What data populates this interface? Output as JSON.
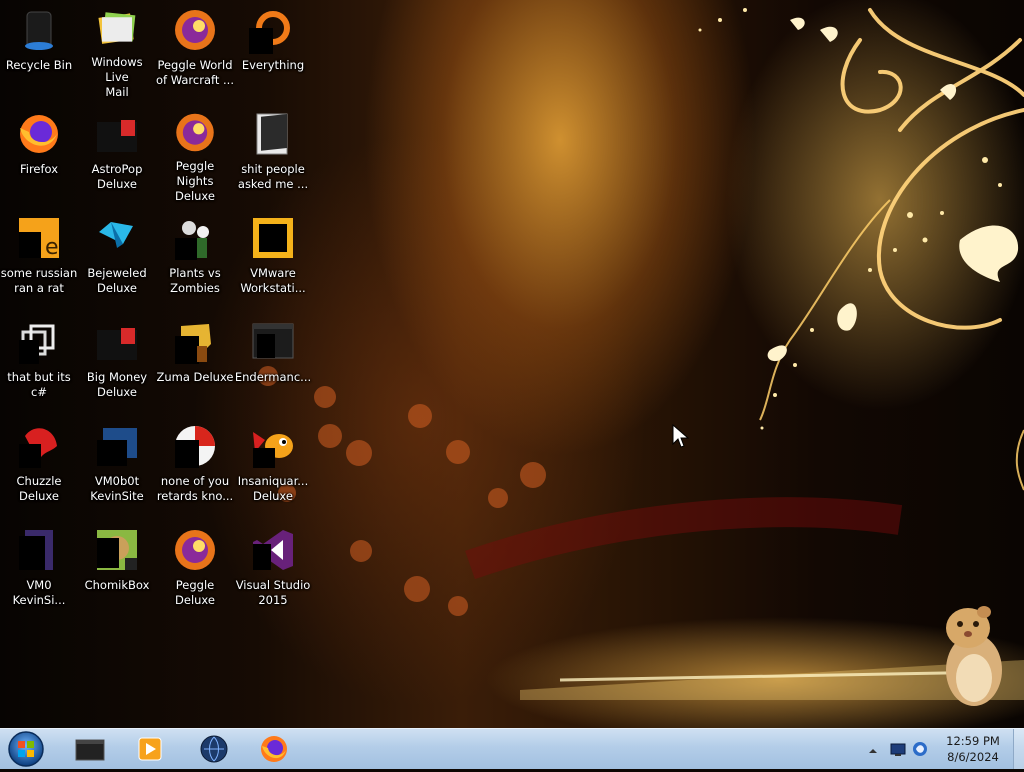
{
  "desktop": {
    "icons": [
      {
        "label": "Recycle Bin",
        "icon": "recycle-bin-icon"
      },
      {
        "label": "Windows Live\nMail",
        "icon": "mail-icon"
      },
      {
        "label": "Peggle World\nof Warcraft ...",
        "icon": "peggle-icon"
      },
      {
        "label": "Everything",
        "icon": "search-ring-icon"
      },
      {
        "label": "Firefox",
        "icon": "firefox-icon"
      },
      {
        "label": "AstroPop\nDeluxe",
        "icon": "game-icon"
      },
      {
        "label": "Peggle Nights\nDeluxe",
        "icon": "peggle-icon"
      },
      {
        "label": "shit people\nasked me ...",
        "icon": "folder-icon"
      },
      {
        "label": "some russian\nran a rat",
        "icon": "java-icon"
      },
      {
        "label": "Bejeweled\nDeluxe",
        "icon": "gem-icon"
      },
      {
        "label": "Plants vs\nZombies",
        "icon": "plant-icon"
      },
      {
        "label": "VMware\nWorkstati...",
        "icon": "vmware-icon"
      },
      {
        "label": "that but its c#",
        "icon": "shortcut-icon"
      },
      {
        "label": "Big Money\nDeluxe",
        "icon": "game-icon"
      },
      {
        "label": "Zuma Deluxe",
        "icon": "zuma-icon"
      },
      {
        "label": "Endermanc...",
        "icon": "console-icon"
      },
      {
        "label": "Chuzzle\nDeluxe",
        "icon": "chuzzle-icon"
      },
      {
        "label": "VM0b0t\nKevinSite",
        "icon": "vm-icon"
      },
      {
        "label": "none of you\nretards kno...",
        "icon": "app-icon"
      },
      {
        "label": "Insaniquar...\nDeluxe",
        "icon": "fish-icon"
      },
      {
        "label": "VM0\nKevinSi...",
        "icon": "document-icon"
      },
      {
        "label": "ChomikBox",
        "icon": "hamster-app-icon"
      },
      {
        "label": "Peggle Deluxe",
        "icon": "peggle-icon"
      },
      {
        "label": "Visual Studio\n2015",
        "icon": "visual-studio-icon"
      }
    ]
  },
  "taskbar": {
    "pinned": [
      {
        "name": "cmd-taskbar-button",
        "icon": "terminal-icon"
      },
      {
        "name": "media-player-taskbar-button",
        "icon": "media-player-icon"
      },
      {
        "name": "app-taskbar-button",
        "icon": "globe-icon"
      },
      {
        "name": "firefox-taskbar-button",
        "icon": "firefox-icon"
      }
    ],
    "clock_time": "12:59 PM",
    "clock_date": "8/6/2024"
  }
}
